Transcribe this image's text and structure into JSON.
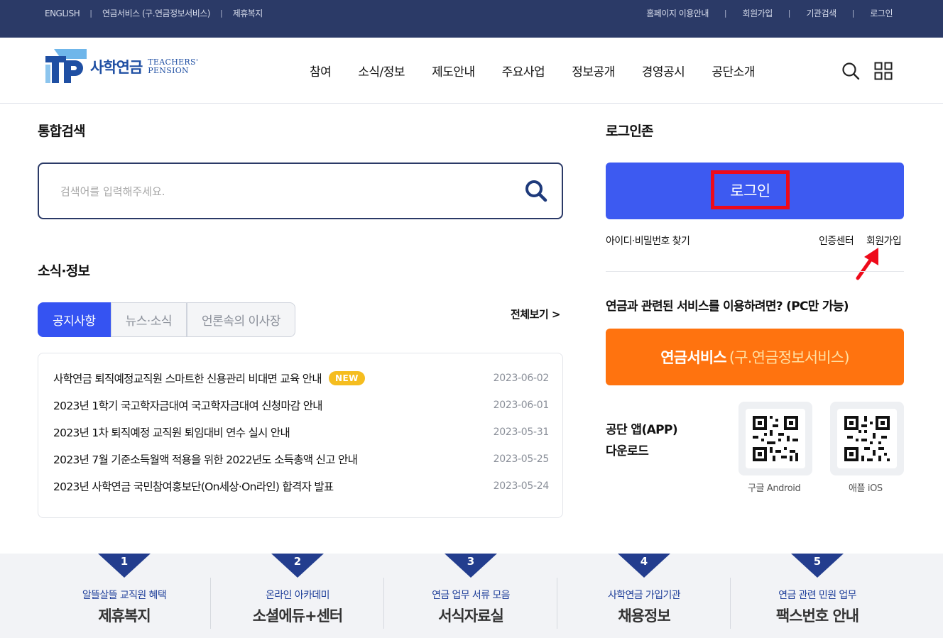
{
  "topbar": {
    "left_links": [
      "ENGLISH",
      "연금서비스 (구.연금정보서비스)",
      "제휴복지"
    ],
    "right_links": [
      "홈페이지 이용안내",
      "회원가입",
      "기관검색",
      "로그인"
    ],
    "separator": "|"
  },
  "header": {
    "logo_ko": "사학연금",
    "logo_en_line1": "TEACHERS'",
    "logo_en_line2": "PENSION",
    "nav": [
      "참여",
      "소식/정보",
      "제도안내",
      "주요사업",
      "정보공개",
      "경영공시",
      "공단소개"
    ]
  },
  "search": {
    "title": "통합검색",
    "placeholder": "검색어를 입력해주세요."
  },
  "news": {
    "title": "소식·정보",
    "tabs": [
      "공지사항",
      "뉴스·소식",
      "언론속의 이사장"
    ],
    "more": "전체보기 >",
    "badge": "NEW",
    "items": [
      {
        "title": "사학연금 퇴직예정교직원 스마트한 신용관리 비대면 교육 안내",
        "date": "2023-06-02",
        "is_new": true
      },
      {
        "title": "2023년 1학기 국고학자금대여 국고학자금대여 신청마감 안내",
        "date": "2023-06-01",
        "is_new": false
      },
      {
        "title": "2023년 1차 퇴직예정 교직원 퇴임대비 연수 실시 안내",
        "date": "2023-05-31",
        "is_new": false
      },
      {
        "title": "2023년 7월 기준소득월액 적용을 위한 2022년도 소득총액 신고 안내",
        "date": "2023-05-25",
        "is_new": false
      },
      {
        "title": "2023년 사학연금 국민참여홍보단(On세상·On라인) 합격자 발표",
        "date": "2023-05-24",
        "is_new": false
      }
    ]
  },
  "login": {
    "title": "로그인존",
    "button": "로그인",
    "find": "아이디·비밀번호 찾기",
    "cert": "인증센터",
    "join": "회원가입"
  },
  "service": {
    "question": "연금과 관련된 서비스를 이용하려면? (PC만 가능)",
    "button_main": "연금서비스",
    "button_sub": "(구.연금정보서비스)"
  },
  "app": {
    "line1": "공단 앱(APP)",
    "line2": "다운로드",
    "android": "구글 Android",
    "ios": "애플 iOS"
  },
  "bottom": [
    {
      "num": "1",
      "sub": "알뜰살뜰 교직원 혜택",
      "main": "제휴복지"
    },
    {
      "num": "2",
      "sub": "온라인 아카데미",
      "main": "소셜에듀+센터"
    },
    {
      "num": "3",
      "sub": "연금 업무 서류 모음",
      "main": "서식자료실"
    },
    {
      "num": "4",
      "sub": "사학연금 가입기관",
      "main": "채용정보"
    },
    {
      "num": "5",
      "sub": "연금 관련 민원 업무",
      "main": "팩스번호 안내"
    }
  ],
  "colors": {
    "topbar": "#2b3a67",
    "primary_blue": "#3d5af1",
    "orange": "#ff730f",
    "highlight_red": "#ee0a1a",
    "badge_yellow": "#f5bd1f",
    "flag_navy": "#233d8e"
  }
}
